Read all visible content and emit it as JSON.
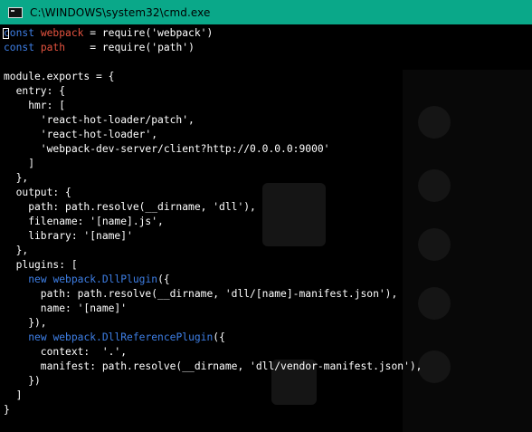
{
  "window": {
    "title": "C:\\WINDOWS\\system32\\cmd.exe",
    "icon": "cmd-icon"
  },
  "colors": {
    "titlebar": "#0aa889",
    "background": "#000000",
    "keyword": "#3e7fe6",
    "identifier": "#e5533f",
    "text": "#ffffff"
  },
  "console": {
    "lines": [
      [
        {
          "t": "const",
          "c": "kw"
        },
        {
          "t": " "
        },
        {
          "t": "webpack",
          "c": "var"
        },
        {
          "t": " = require('webpack')"
        }
      ],
      [
        {
          "t": "const",
          "c": "kw"
        },
        {
          "t": " "
        },
        {
          "t": "path",
          "c": "var"
        },
        {
          "t": "    = require('path')"
        }
      ],
      [
        {
          "t": ""
        }
      ],
      [
        {
          "t": "module.exports = {"
        }
      ],
      [
        {
          "t": "  entry: {"
        }
      ],
      [
        {
          "t": "    hmr: ["
        }
      ],
      [
        {
          "t": "      'react-hot-loader/patch',"
        }
      ],
      [
        {
          "t": "      'react-hot-loader',"
        }
      ],
      [
        {
          "t": "      'webpack-dev-server/client?http://0.0.0.0:9000'"
        }
      ],
      [
        {
          "t": "    ]"
        }
      ],
      [
        {
          "t": "  },"
        }
      ],
      [
        {
          "t": "  output: {"
        }
      ],
      [
        {
          "t": "    path: path.resolve(__dirname, 'dll'),"
        }
      ],
      [
        {
          "t": "    filename: '[name].js',"
        }
      ],
      [
        {
          "t": "    library: '[name]'"
        }
      ],
      [
        {
          "t": "  },"
        }
      ],
      [
        {
          "t": "  plugins: ["
        }
      ],
      [
        {
          "t": "    "
        },
        {
          "t": "new",
          "c": "kw"
        },
        {
          "t": " "
        },
        {
          "t": "webpack.DllPlugin",
          "c": "cls"
        },
        {
          "t": "({"
        }
      ],
      [
        {
          "t": "      path: path.resolve(__dirname, 'dll/[name]-manifest.json'),"
        }
      ],
      [
        {
          "t": "      name: '[name]'"
        }
      ],
      [
        {
          "t": "    }),"
        }
      ],
      [
        {
          "t": "    "
        },
        {
          "t": "new",
          "c": "kw"
        },
        {
          "t": " "
        },
        {
          "t": "webpack.DllReferencePlugin",
          "c": "cls"
        },
        {
          "t": "({"
        }
      ],
      [
        {
          "t": "      context:  '.',"
        }
      ],
      [
        {
          "t": "      manifest: path.resolve(__dirname, 'dll/vendor-manifest.json'),"
        }
      ],
      [
        {
          "t": "    })"
        }
      ],
      [
        {
          "t": "  ]"
        }
      ],
      [
        {
          "t": "}"
        }
      ]
    ]
  }
}
